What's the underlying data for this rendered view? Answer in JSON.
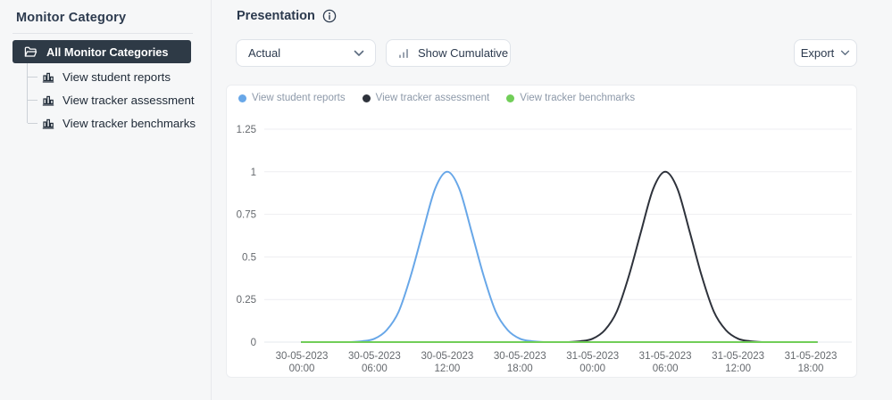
{
  "sidebar": {
    "title": "Monitor Category",
    "root": {
      "label": "All Monitor Categories",
      "selected": true
    },
    "items": [
      {
        "label": "View student reports"
      },
      {
        "label": "View tracker assessment"
      },
      {
        "label": "View tracker benchmarks"
      }
    ]
  },
  "toolbar": {
    "section_title": "Presentation",
    "presentation_select_value": "Actual",
    "show_cumulative_label": "Show Cumulative",
    "export_label": "Export"
  },
  "colors": {
    "page_bg": "#f6f7f8",
    "card_bg": "#ffffff",
    "selected_item_bg": "#2e3a46",
    "heading_text": "#2c3a4e",
    "series_blue": "#68a7e8",
    "series_black": "#2e323b",
    "series_green": "#71ce58",
    "legend_text": "#8d99a9",
    "axis_text": "#65696e",
    "grid_line": "#eeeef1",
    "zero_line": "#e4e8ee",
    "control_border": "#dfe3e9"
  },
  "chart_data": {
    "type": "line",
    "title": "",
    "legend_position": "top",
    "grid": "horizontal-only",
    "y_axis": {
      "range": [
        0,
        1.25
      ],
      "ticks": [
        {
          "value": 0,
          "label": "0"
        },
        {
          "value": 0.25,
          "label": "0.25"
        },
        {
          "value": 0.5,
          "label": "0.5"
        },
        {
          "value": 0.75,
          "label": "0.75"
        },
        {
          "value": 1,
          "label": "1"
        },
        {
          "value": 1.25,
          "label": "1.25"
        }
      ]
    },
    "x_axis": {
      "unit": "hours since 30-05-2023 00:00",
      "visible_range_hours": [
        -3.1,
        45.4
      ],
      "ticks": [
        {
          "hour": 0,
          "date": "30-05-2023",
          "time": "00:00"
        },
        {
          "hour": 6,
          "date": "30-05-2023",
          "time": "06:00"
        },
        {
          "hour": 12,
          "date": "30-05-2023",
          "time": "12:00"
        },
        {
          "hour": 18,
          "date": "30-05-2023",
          "time": "18:00"
        },
        {
          "hour": 24,
          "date": "31-05-2023",
          "time": "00:00"
        },
        {
          "hour": 30,
          "date": "31-05-2023",
          "time": "06:00"
        },
        {
          "hour": 36,
          "date": "31-05-2023",
          "time": "12:00"
        },
        {
          "hour": 42,
          "date": "31-05-2023",
          "time": "18:00"
        }
      ]
    },
    "series": [
      {
        "id": "view-student-reports",
        "name": "View student reports",
        "color": "#68a7e8",
        "peak": {
          "date": "30-05-2023",
          "time": "12:00",
          "value": 1
        },
        "points": [
          [
            0,
            0
          ],
          [
            3,
            0
          ],
          [
            4,
            0
          ],
          [
            5,
            0.005
          ],
          [
            6,
            0.02
          ],
          [
            7,
            0.07
          ],
          [
            8,
            0.18
          ],
          [
            9,
            0.39
          ],
          [
            10,
            0.65
          ],
          [
            11,
            0.9
          ],
          [
            12,
            1
          ],
          [
            13,
            0.9
          ],
          [
            14,
            0.65
          ],
          [
            15,
            0.39
          ],
          [
            16,
            0.18
          ],
          [
            17,
            0.07
          ],
          [
            18,
            0.02
          ],
          [
            19,
            0.005
          ],
          [
            20,
            0
          ],
          [
            21,
            0
          ],
          [
            42.5,
            0
          ]
        ]
      },
      {
        "id": "view-tracker-assessment",
        "name": "View tracker assessment",
        "color": "#2e323b",
        "peak": {
          "date": "31-05-2023",
          "time": "06:00",
          "value": 1
        },
        "points": [
          [
            0,
            0
          ],
          [
            21,
            0
          ],
          [
            22,
            0
          ],
          [
            23,
            0.005
          ],
          [
            24,
            0.02
          ],
          [
            25,
            0.07
          ],
          [
            26,
            0.18
          ],
          [
            27,
            0.39
          ],
          [
            28,
            0.65
          ],
          [
            29,
            0.9
          ],
          [
            30,
            1
          ],
          [
            31,
            0.9
          ],
          [
            32,
            0.65
          ],
          [
            33,
            0.39
          ],
          [
            34,
            0.18
          ],
          [
            35,
            0.07
          ],
          [
            36,
            0.02
          ],
          [
            37,
            0.005
          ],
          [
            38,
            0
          ],
          [
            39,
            0
          ],
          [
            42.5,
            0
          ]
        ]
      },
      {
        "id": "view-tracker-benchmarks",
        "name": "View tracker benchmarks",
        "color": "#71ce58",
        "points": [
          [
            0,
            0
          ],
          [
            10,
            0
          ],
          [
            20,
            0
          ],
          [
            30,
            0
          ],
          [
            42.5,
            0
          ]
        ]
      }
    ]
  }
}
